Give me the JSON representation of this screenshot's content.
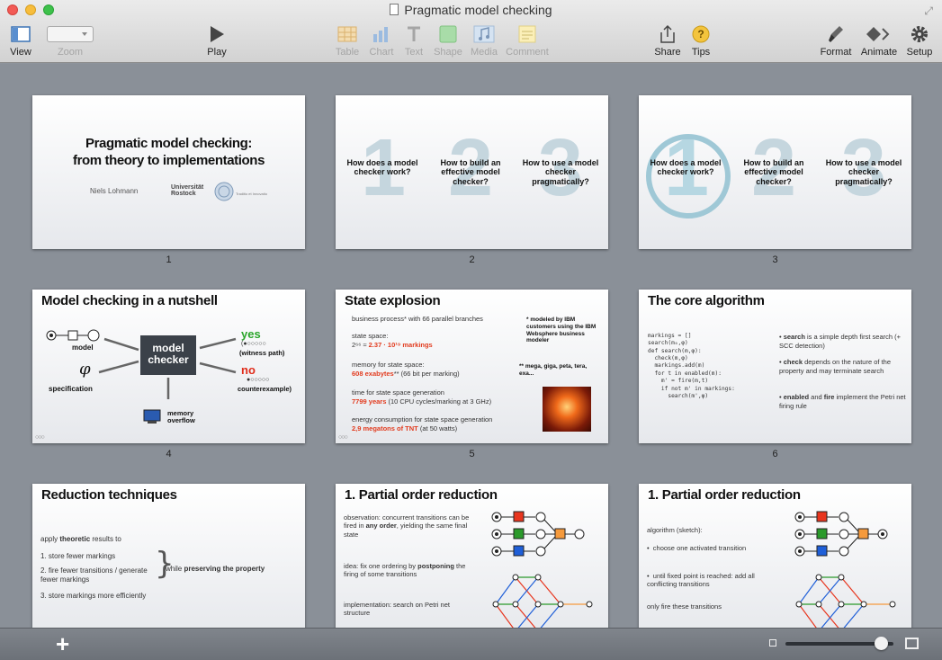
{
  "window": {
    "title": "Pragmatic model checking"
  },
  "toolbar": {
    "view": "View",
    "zoom": "Zoom",
    "play": "Play",
    "table": "Table",
    "chart": "Chart",
    "text": "Text",
    "shape": "Shape",
    "media": "Media",
    "comment": "Comment",
    "share": "Share",
    "tips": "Tips",
    "format": "Format",
    "animate": "Animate",
    "setup": "Setup"
  },
  "slides": [
    {
      "number": "1",
      "title_line1": "Pragmatic model checking:",
      "title_line2": "from theory to implementations",
      "author": "Niels Lohmann",
      "logo": "Universität Rostock",
      "logo_tag": "Traditio et Innovatio"
    },
    {
      "number": "2",
      "q1": "How does a model checker work?",
      "q2": "How to build an effective model checker?",
      "q3": "How to use a model checker pragmatically?",
      "bg1": "1",
      "bg2": "2",
      "bg3": "3"
    },
    {
      "number": "3",
      "q1": "How does a model checker work?",
      "q2": "How to build an effective model checker?",
      "q3": "How to use a model checker pragmatically?",
      "bg1": "1",
      "bg2": "2",
      "bg3": "3"
    },
    {
      "number": "4",
      "title": "Model checking in a nutshell",
      "model": "model",
      "spec": "specification",
      "phi": "φ",
      "box1": "model",
      "box2": "checker",
      "yes": "yes",
      "witness": "(witness path)",
      "no": "no",
      "counter": "counterexample)",
      "mem1": "memory",
      "mem2": "overflow",
      "path_glyph": "(●○○○○○",
      "path_glyph2": "●○○○○○"
    },
    {
      "number": "5",
      "title": "State explosion",
      "l1": "business process* with 66 parallel branches",
      "l2": "state space:",
      "l3a": "2⁶⁶ ≈",
      "l3b": "2.37 · 10¹⁹ markings",
      "l4": "memory for state space:",
      "l5a": "608 exabytes",
      "l5b": "** (66 bit per marking)",
      "l6": "time for state space generation",
      "l7a": "7799 years",
      "l7b": "(10 CPU cycles/marking at 3 GHz)",
      "l8": "energy consumption for state space generation",
      "l9a": "2,9 megatons of TNT",
      "l9b": "(at 50 watts)",
      "n1": "* modeled by IBM customers using the IBM Websphere business modeler",
      "n2": "** mega, giga, peta, tera, exa..."
    },
    {
      "number": "6",
      "title": "The core algorithm",
      "code": [
        "markings = []",
        "search(m₀,φ)",
        "",
        "def search(m,φ):",
        "  check(m,φ)",
        "  markings.add(m)",
        "  for t in enabled(m):",
        "    m' = fire(m,t)",
        "    if not m' in markings:",
        "      search(m',φ)"
      ],
      "b1a": "search",
      "b1b": " is a simple depth first search (+ SCC detection)",
      "b2a": "check",
      "b2b": " depends on the nature of the property and may terminate search",
      "b3a": "enabled",
      "b3b": " and ",
      "b3c": "fire",
      "b3d": " implement the Petri net firing rule"
    },
    {
      "number": "7",
      "title": "Reduction techniques",
      "l1a": "apply ",
      "l1b": "theoretic",
      "l1c": " results to",
      "i1": "1.  store fewer markings",
      "i2": "2.  fire fewer transitions / generate fewer markings",
      "i3": "3.  store markings more efficiently",
      "side_a": "while ",
      "side_b": "preserving the property"
    },
    {
      "number": "8",
      "title": "1. Partial order reduction",
      "p1a": "observation: concurrent transitions can be fired in ",
      "p1b": "any order",
      "p1c": ", yielding the same final state",
      "p2a": "idea: fix one ordering by ",
      "p2b": "postponing",
      "p2c": " the firing of some transitions",
      "p3": "implementation: search on Petri net structure"
    },
    {
      "number": "9",
      "title": "1. Partial order reduction",
      "l1": "algorithm (sketch):",
      "b1": "choose one activated transition",
      "b2": "until fixed point is reached: add all conflicting transitions",
      "l2": "only fire these transitions"
    }
  ],
  "bottom": {
    "add": "+"
  }
}
